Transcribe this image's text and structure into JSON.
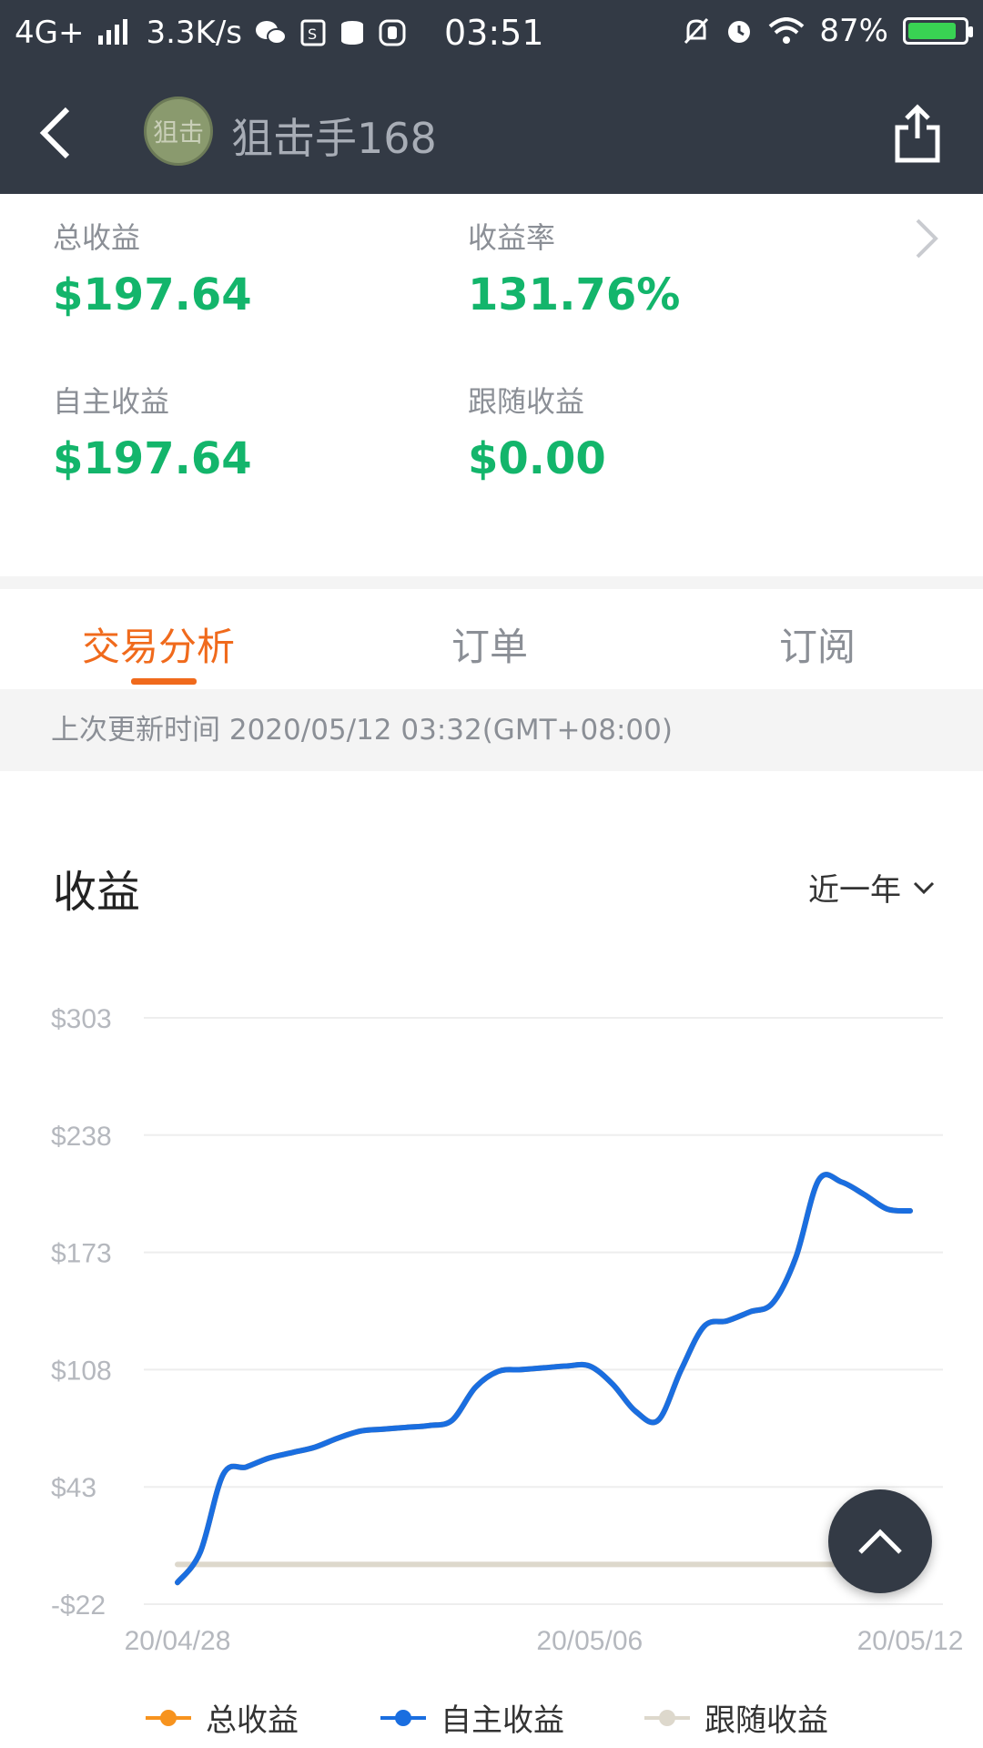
{
  "status_bar": {
    "network": "4G+",
    "speed": "3.3K/s",
    "time": "03:51",
    "battery": "87%",
    "battery_level": 0.87
  },
  "header": {
    "avatar_text": "狙击",
    "username": "狙击手168"
  },
  "stats": {
    "total_label": "总收益",
    "total_value": "$197.64",
    "rate_label": "收益率",
    "rate_value": "131.76%",
    "self_label": "自主收益",
    "self_value": "$197.64",
    "follow_label": "跟随收益",
    "follow_value": "$0.00"
  },
  "tabs": [
    {
      "label": "交易分析",
      "active": true
    },
    {
      "label": "订单",
      "active": false
    },
    {
      "label": "订阅",
      "active": false
    }
  ],
  "update_text": "上次更新时间 2020/05/12 03:32(GMT+08:00)",
  "chart_section": {
    "title": "收益",
    "range": "近一年"
  },
  "colors": {
    "header_bg": "#333a45",
    "accent": "#f06a1c",
    "profit_green": "#13b56b",
    "series_total": "#f7931e",
    "series_self": "#1a6ee0",
    "series_follow": "#ddd8cc"
  },
  "icons": {
    "back": "chevron-left-icon",
    "share": "share-icon",
    "stats_arrow": "chevron-right-icon",
    "range_dropdown": "chevron-down-icon",
    "fab": "chevron-up-icon"
  },
  "chart_data": {
    "type": "line",
    "ylim": [
      -22,
      303
    ],
    "y_ticks": [
      "$303",
      "$238",
      "$173",
      "$108",
      "$43",
      "-$22"
    ],
    "y_tick_values": [
      303,
      238,
      173,
      108,
      43,
      -22
    ],
    "x_ticks": [
      "20/04/28",
      "20/05/06",
      "20/05/12"
    ],
    "x_tick_positions": [
      0,
      9,
      16
    ],
    "series": [
      {
        "name": "总收益",
        "color": "#f7931e",
        "x": [
          0,
          0.5,
          1,
          1.5,
          2,
          2.5,
          3,
          3.5,
          4,
          4.5,
          5,
          5.5,
          6,
          6.5,
          7,
          7.5,
          8,
          8.5,
          9,
          9.5,
          10,
          10.5,
          11,
          11.5,
          12,
          12.5,
          13,
          13.5,
          14,
          14.5,
          15,
          15.5,
          16
        ],
        "values": [
          -10,
          7,
          50,
          54,
          59,
          62,
          65,
          70,
          74,
          75,
          76,
          77,
          80,
          98,
          107,
          108,
          109,
          110,
          110,
          100,
          85,
          80,
          108,
          132,
          135,
          140,
          145,
          170,
          213,
          212,
          205,
          197,
          196
        ]
      },
      {
        "name": "自主收益",
        "color": "#1a6ee0",
        "x": [
          0,
          0.5,
          1,
          1.5,
          2,
          2.5,
          3,
          3.5,
          4,
          4.5,
          5,
          5.5,
          6,
          6.5,
          7,
          7.5,
          8,
          8.5,
          9,
          9.5,
          10,
          10.5,
          11,
          11.5,
          12,
          12.5,
          13,
          13.5,
          14,
          14.5,
          15,
          15.5,
          16
        ],
        "values": [
          -10,
          7,
          50,
          54,
          59,
          62,
          65,
          70,
          74,
          75,
          76,
          77,
          80,
          98,
          107,
          108,
          109,
          110,
          110,
          100,
          85,
          80,
          108,
          132,
          135,
          140,
          145,
          170,
          213,
          212,
          205,
          197,
          196
        ]
      },
      {
        "name": "跟随收益",
        "color": "#ddd8cc",
        "x": [
          0,
          16
        ],
        "values": [
          0,
          0
        ]
      }
    ]
  }
}
